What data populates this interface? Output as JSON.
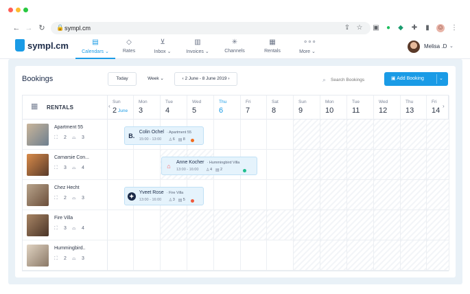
{
  "browser": {
    "url": "sympl.cm",
    "traffic_colors": [
      "#ff5f57",
      "#febc2e",
      "#28c840"
    ]
  },
  "app": {
    "logo": "sympl.cm",
    "brand_color": "#1a9be6",
    "nav": [
      {
        "label": "Calendars",
        "icon": "calendar-icon",
        "active": true,
        "caret": true
      },
      {
        "label": "Rates",
        "icon": "tag-icon"
      },
      {
        "label": "Inbox",
        "icon": "inbox-icon",
        "caret": true
      },
      {
        "label": "Invoices",
        "icon": "invoice-icon",
        "caret": true
      },
      {
        "label": "Channels",
        "icon": "channels-icon"
      },
      {
        "label": "Rentals",
        "icon": "building-icon"
      },
      {
        "label": "More",
        "icon": "more-icon",
        "caret": true
      }
    ],
    "user": {
      "name": "Melisa .D"
    }
  },
  "page": {
    "title": "Bookings",
    "today_label": "Today",
    "view_label": "Week",
    "range_label": "2 June - 8 June 2019",
    "search_placeholder": "Search Bookings",
    "add_booking_label": "Add Booking"
  },
  "calendar": {
    "rentals_label": "RENTALS",
    "days": [
      {
        "dow": "Sun",
        "dom": "2",
        "month": "June"
      },
      {
        "dow": "Mon",
        "dom": "3"
      },
      {
        "dow": "Tue",
        "dom": "4"
      },
      {
        "dow": "Wed",
        "dom": "5"
      },
      {
        "dow": "Thu",
        "dom": "6",
        "today": true
      },
      {
        "dow": "Fri",
        "dom": "7"
      },
      {
        "dow": "Sat",
        "dom": "8"
      },
      {
        "dow": "Sun",
        "dom": "9"
      },
      {
        "dow": "Mon",
        "dom": "10"
      },
      {
        "dow": "Tue",
        "dom": "11"
      },
      {
        "dow": "Wed",
        "dom": "12"
      },
      {
        "dow": "Thu",
        "dom": "13"
      },
      {
        "dow": "Fri",
        "dom": "14"
      }
    ],
    "rentals": [
      {
        "name": "Apartment 55",
        "beds": "2",
        "baths": "3"
      },
      {
        "name": "Carnarsie Con...",
        "beds": "3",
        "baths": "4"
      },
      {
        "name": "Chez Hecht",
        "beds": "2",
        "baths": "3"
      },
      {
        "name": "Fire Villa",
        "beds": "3",
        "baths": "4"
      },
      {
        "name": "Hummingbird..",
        "beds": "2",
        "baths": "3"
      }
    ],
    "bookings": [
      {
        "guest": "Colin Ochel",
        "rental": "Apartment 55",
        "time": "15:00 - 13:00",
        "people": "6",
        "nights": "8",
        "status_color": "#f26b1d",
        "source": "booking-com-icon",
        "source_glyph": "B."
      },
      {
        "guest": "Anne Kocher",
        "rental": "Hummingbird Villa",
        "time": "13:00 - 16:00",
        "people": "4",
        "nights": "2",
        "status_color": "#1fbf8f",
        "source": "airbnb-icon",
        "source_glyph": "⌂"
      },
      {
        "guest": "Yveet Rose",
        "rental": "Fire Villa",
        "time": "13:00 - 16:00",
        "people": "3",
        "nights": "5",
        "status_color": "#f05a3c",
        "source": "channel-icon",
        "source_glyph": "✦"
      }
    ]
  }
}
